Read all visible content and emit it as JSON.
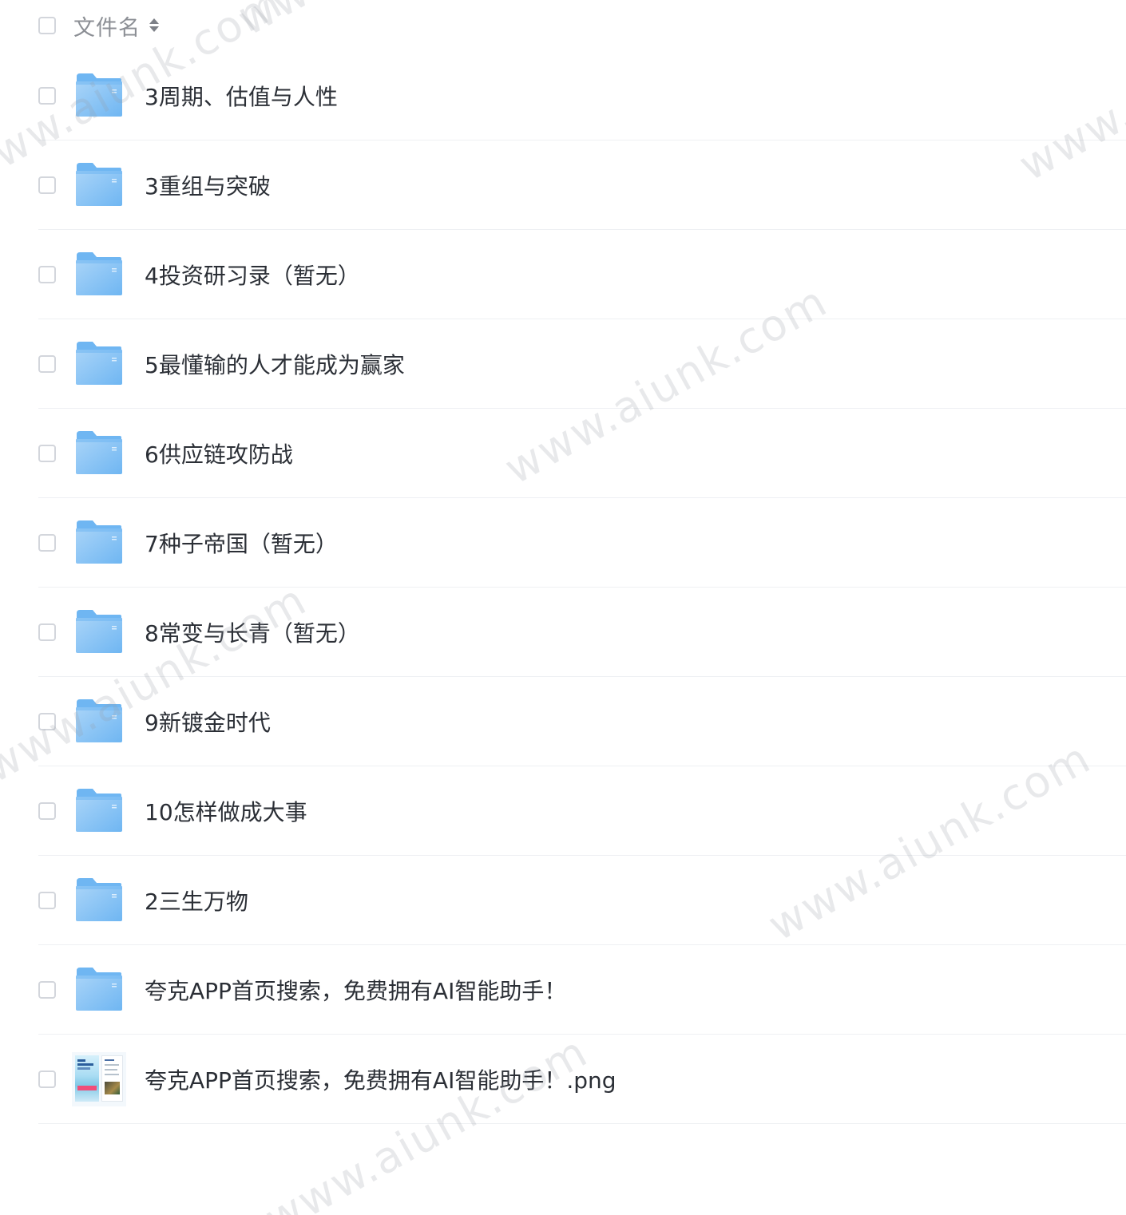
{
  "header": {
    "name_label": "文件名"
  },
  "files": [
    {
      "name": "3周期、估值与人性",
      "type": "folder"
    },
    {
      "name": "3重组与突破",
      "type": "folder"
    },
    {
      "name": "4投资研习录（暂无）",
      "type": "folder"
    },
    {
      "name": "5最懂输的人才能成为赢家",
      "type": "folder"
    },
    {
      "name": "6供应链攻防战",
      "type": "folder"
    },
    {
      "name": "7种子帝国（暂无）",
      "type": "folder"
    },
    {
      "name": "8常变与长青（暂无）",
      "type": "folder"
    },
    {
      "name": "9新镀金时代",
      "type": "folder"
    },
    {
      "name": "10怎样做成大事",
      "type": "folder"
    },
    {
      "name": "2三生万物",
      "type": "folder"
    },
    {
      "name": "夸克APP首页搜索，免费拥有AI智能助手！",
      "type": "folder"
    },
    {
      "name": "夸克APP首页搜索，免费拥有AI智能助手！.png",
      "type": "image"
    }
  ],
  "watermark": {
    "text": "www.aiunk.com"
  },
  "colors": {
    "folder": "#6fb6f2",
    "folder_light": "#a9d4f8",
    "text": "#2b2f36",
    "header_text": "#8c8f95",
    "divider": "#eef0f3"
  }
}
